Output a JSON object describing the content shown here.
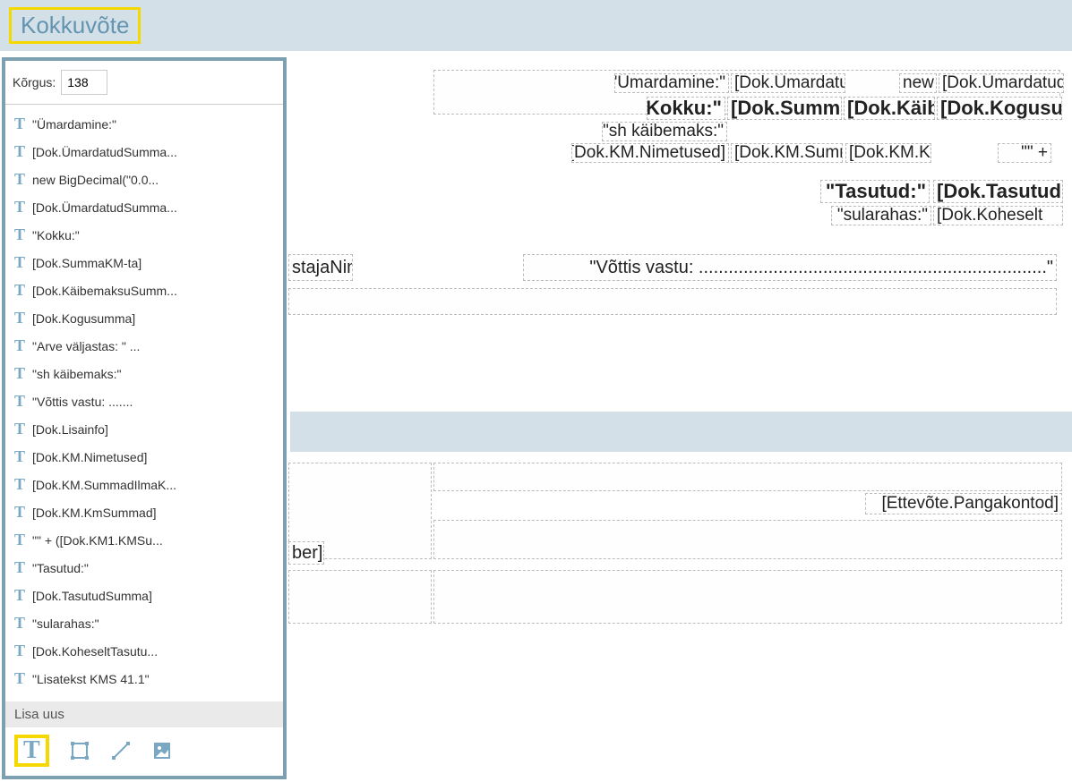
{
  "header": {
    "title": "Kokkuvõte"
  },
  "sidebar": {
    "height_label": "Kõrgus:",
    "height_value": "138",
    "items": [
      "\"Ümardamine:\"",
      "[Dok.ÜmardatudSumma...",
      "new BigDecimal(\"0.0...",
      "[Dok.ÜmardatudSumma...",
      "\"Kokku:\"",
      "[Dok.SummaKM-ta]",
      "[Dok.KäibemaksuSumm...",
      "[Dok.Kogusumma]",
      "\"Arve väljastas: \" ...",
      "\"sh käibemaks:\"",
      "\"Võttis vastu: .......",
      "[Dok.Lisainfo]",
      "[Dok.KM.Nimetused]",
      "[Dok.KM.SummadIlmaK...",
      "[Dok.KM.KmSummad]",
      "\"\" + ([Dok.KM1.KMSu...",
      "\"Tasutud:\"",
      "[Dok.TasutudSumma]",
      "\"sularahas:\"",
      "[Dok.KoheseltTasutu...",
      "\"Lisatekst KMS 41.1\""
    ],
    "add_new": "Lisa uus"
  },
  "canvas": {
    "umardamine_label": "\"Ümardamine:\"",
    "umardatud1": "[Dok.Ümardatud",
    "newdec": "new",
    "umardatud2": "[Dok.Ümardatud",
    "kokku_label": "\"Kokku:\"",
    "summa_km": "[Dok.Summa",
    "kaib": "[Dok.Käib",
    "kogusu": "[Dok.Kogusu",
    "sh_label": "\"sh käibemaks:\"",
    "km_nim": "[Dok.KM.Nimetused]",
    "km_summ": "[Dok.KM.Summ",
    "km_kn": "[Dok.KM.Kn",
    "km1": "\"\" +",
    "tasutud_label": "\"Tasutud:\"",
    "tasutud_val": "[Dok.Tasutud",
    "sularahas_label": "\"sularahas:\"",
    "koheselt": "[Dok.Koheselt",
    "staja": "stajaNimi]",
    "vottis": "\"Võttis vastu: ......................................................................\"",
    "pangakontod": "[Ettevõte.Pangakontod]",
    "ber": "ber]"
  }
}
